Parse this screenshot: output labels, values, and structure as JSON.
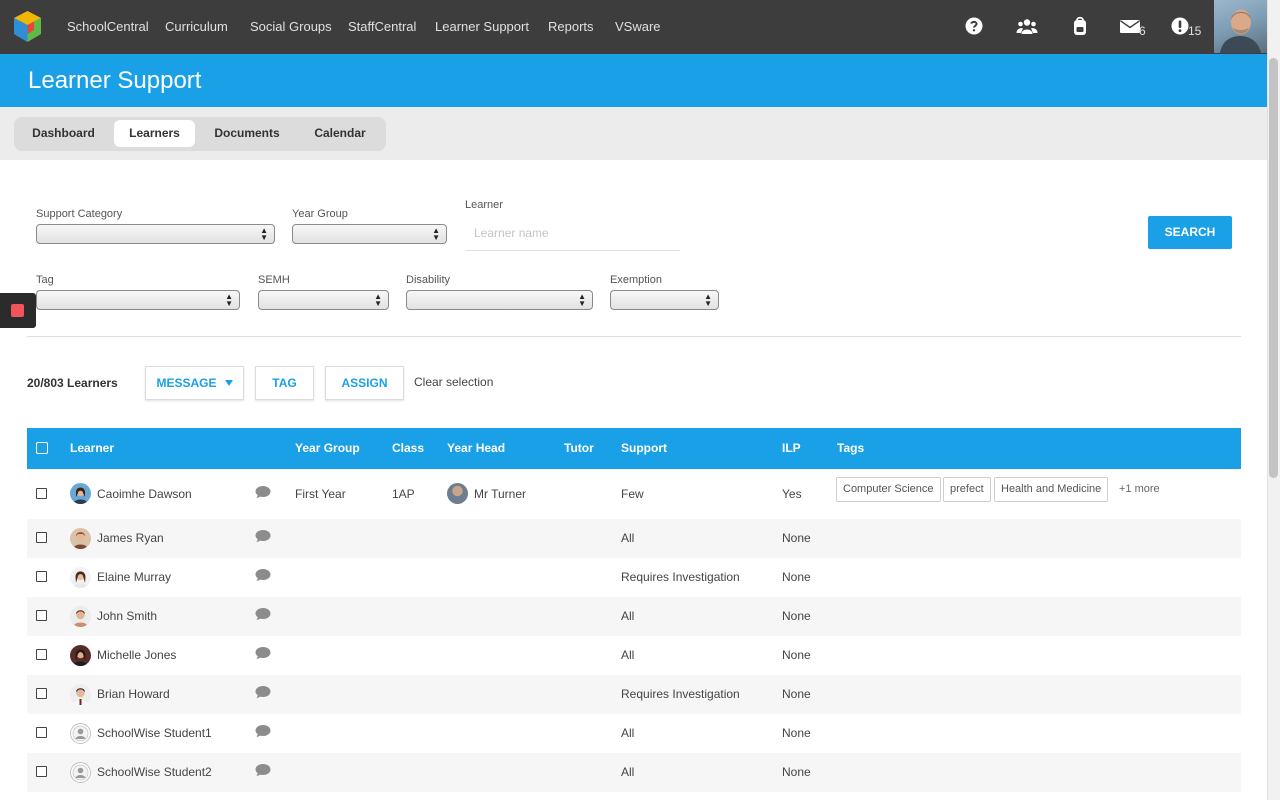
{
  "topnav": {
    "items": [
      "SchoolCentral",
      "Curriculum",
      "Social Groups",
      "StaffCentral",
      "Learner Support",
      "Reports",
      "VSware"
    ],
    "icons": [
      "help-icon",
      "groups-icon",
      "backpack-icon",
      "mail-icon",
      "alert-icon"
    ],
    "mail_count": "6",
    "alert_count": "15"
  },
  "header": {
    "title": "Learner Support"
  },
  "tabs": [
    {
      "label": "Dashboard",
      "active": false
    },
    {
      "label": "Learners",
      "active": true
    },
    {
      "label": "Documents",
      "active": false
    },
    {
      "label": "Calendar",
      "active": false
    }
  ],
  "filters": {
    "support_category": {
      "label": "Support Category",
      "value": ""
    },
    "year_group": {
      "label": "Year Group",
      "value": ""
    },
    "learner": {
      "label": "Learner",
      "placeholder": "Learner name",
      "value": ""
    },
    "tag": {
      "label": "Tag",
      "value": ""
    },
    "semh": {
      "label": "SEMH",
      "value": ""
    },
    "disability": {
      "label": "Disability",
      "value": ""
    },
    "exemption": {
      "label": "Exemption",
      "value": ""
    },
    "search_label": "SEARCH"
  },
  "actions": {
    "count": "20/803 Learners",
    "message": "MESSAGE",
    "tag": "TAG",
    "assign": "ASSIGN",
    "clear": "Clear selection"
  },
  "table": {
    "columns": [
      "Learner",
      "Year Group",
      "Class",
      "Year Head",
      "Tutor",
      "Support",
      "ILP",
      "Tags"
    ],
    "rows": [
      {
        "name": "Caoimhe Dawson",
        "year_group": "First Year",
        "class": "1AP",
        "year_head": "Mr Turner",
        "tutor": "",
        "support": "Few",
        "ilp": "Yes",
        "tags": [
          "Computer Science",
          "prefect",
          "Health and Medicine"
        ],
        "more": "+1 more"
      },
      {
        "name": "James Ryan",
        "year_group": "",
        "class": "",
        "year_head": "",
        "tutor": "",
        "support": "All",
        "ilp": "None",
        "tags": [],
        "more": ""
      },
      {
        "name": "Elaine Murray",
        "year_group": "",
        "class": "",
        "year_head": "",
        "tutor": "",
        "support": "Requires Investigation",
        "ilp": "None",
        "tags": [],
        "more": ""
      },
      {
        "name": "John Smith",
        "year_group": "",
        "class": "",
        "year_head": "",
        "tutor": "",
        "support": "All",
        "ilp": "None",
        "tags": [],
        "more": ""
      },
      {
        "name": "Michelle Jones",
        "year_group": "",
        "class": "",
        "year_head": "",
        "tutor": "",
        "support": "All",
        "ilp": "None",
        "tags": [],
        "more": ""
      },
      {
        "name": "Brian Howard",
        "year_group": "",
        "class": "",
        "year_head": "",
        "tutor": "",
        "support": "Requires Investigation",
        "ilp": "None",
        "tags": [],
        "more": ""
      },
      {
        "name": "SchoolWise Student1",
        "year_group": "",
        "class": "",
        "year_head": "",
        "tutor": "",
        "support": "All",
        "ilp": "None",
        "tags": [],
        "more": ""
      },
      {
        "name": "SchoolWise Student2",
        "year_group": "",
        "class": "",
        "year_head": "",
        "tutor": "",
        "support": "All",
        "ilp": "None",
        "tags": [],
        "more": ""
      }
    ]
  },
  "colors": {
    "accent": "#1aa0e6",
    "topbar": "#3d3d3d",
    "side_tab_square": "#f2545b"
  }
}
